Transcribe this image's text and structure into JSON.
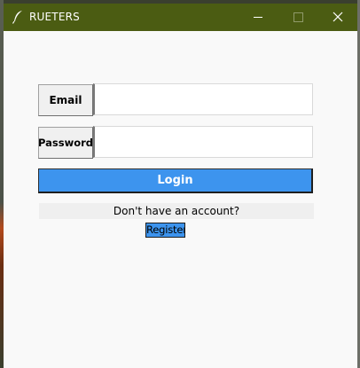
{
  "window": {
    "title": "RUETERS",
    "icon": "feather-icon",
    "controls": {
      "minimize_icon": "minimize-icon",
      "maximize_icon": "maximize-icon",
      "close_icon": "close-icon"
    }
  },
  "form": {
    "email_label": "Email",
    "email_value": "",
    "password_label": "Password",
    "password_value": "",
    "login_label": "Login",
    "no_account_text": "Don't have an account?",
    "register_label": "Register"
  },
  "colors": {
    "titlebar": "#4b5c12",
    "accent_button": "#3d94ee",
    "window_bg": "#f9f9f9"
  }
}
